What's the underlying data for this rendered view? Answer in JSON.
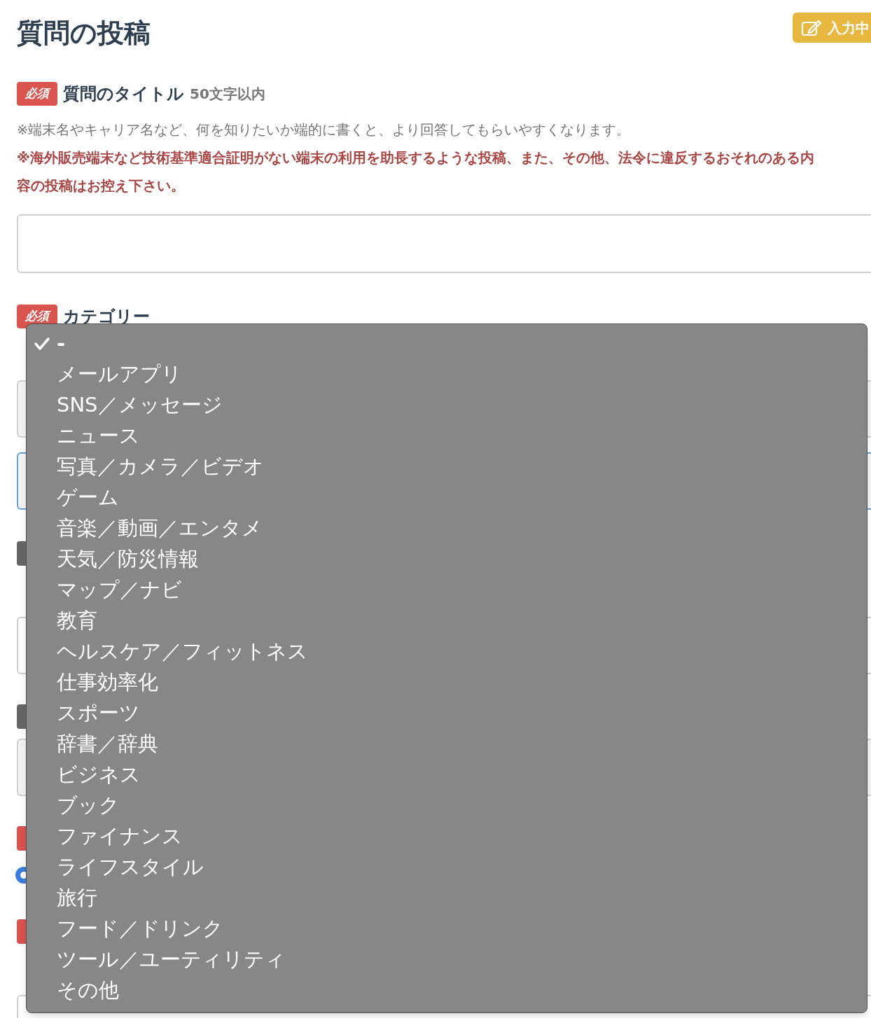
{
  "page": {
    "title": "質問の投稿",
    "status_button": "入力中"
  },
  "title_field": {
    "badge": "必須",
    "label": "質問のタイトル",
    "limit": "50文字以内",
    "hint": "※端末名やキャリア名など、何を知りたいか端的に書くと、より回答してもらいやすくなります。",
    "warning_lines": [
      "※海外販売端末など技術基準適合証明がない端末の利用を助長するような投稿、また、その他、法令に違反するおそれのある内",
      "容の投稿はお控え下さい。"
    ]
  },
  "category_field": {
    "badge": "必須",
    "label": "カテゴリー"
  },
  "radio": {
    "checked": true
  },
  "dropdown": {
    "options": [
      {
        "label": "-",
        "selected": true
      },
      {
        "label": "メールアプリ",
        "selected": false
      },
      {
        "label": "SNS／メッセージ",
        "selected": false
      },
      {
        "label": "ニュース",
        "selected": false
      },
      {
        "label": "写真／カメラ／ビデオ",
        "selected": false
      },
      {
        "label": "ゲーム",
        "selected": false
      },
      {
        "label": "音楽／動画／エンタメ",
        "selected": false
      },
      {
        "label": "天気／防災情報",
        "selected": false
      },
      {
        "label": "マップ／ナビ",
        "selected": false
      },
      {
        "label": "教育",
        "selected": false
      },
      {
        "label": "ヘルスケア／フィットネス",
        "selected": false
      },
      {
        "label": "仕事効率化",
        "selected": false
      },
      {
        "label": "スポーツ",
        "selected": false
      },
      {
        "label": "辞書／辞典",
        "selected": false
      },
      {
        "label": "ビジネス",
        "selected": false
      },
      {
        "label": "ブック",
        "selected": false
      },
      {
        "label": "ファイナンス",
        "selected": false
      },
      {
        "label": "ライフスタイル",
        "selected": false
      },
      {
        "label": "旅行",
        "selected": false
      },
      {
        "label": "フード／ドリンク",
        "selected": false
      },
      {
        "label": "ツール／ユーティリティ",
        "selected": false
      },
      {
        "label": "その他",
        "selected": false
      }
    ]
  }
}
